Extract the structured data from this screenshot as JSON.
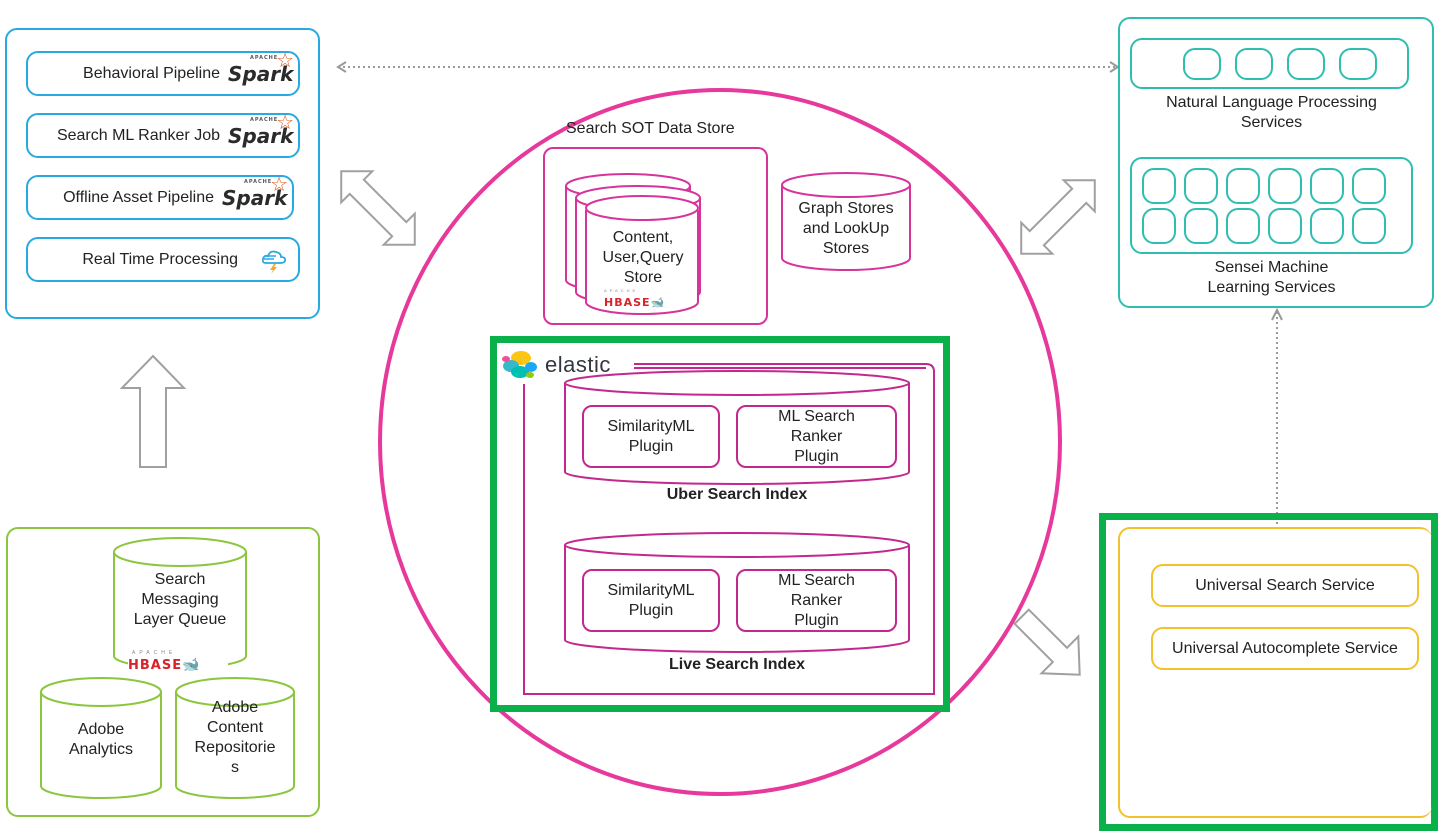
{
  "batch_panel": {
    "items": [
      {
        "label": "Behavioral Pipeline",
        "logo": "Spark",
        "logo_prefix": "APACHE",
        "icon": "spark-icon"
      },
      {
        "label": "Search ML Ranker Job",
        "logo": "Spark",
        "logo_prefix": "APACHE",
        "icon": "spark-icon"
      },
      {
        "label": "Offline Asset Pipeline",
        "logo": "Spark",
        "logo_prefix": "APACHE",
        "icon": "spark-icon"
      },
      {
        "label": "Real Time Processing",
        "icon": "storm-cloud-icon"
      }
    ]
  },
  "sources_panel": {
    "queue": {
      "label_lines": [
        "Search",
        "Messaging",
        "Layer Queue"
      ],
      "logo": "HBASE",
      "logo_prefix": "APACHE"
    },
    "analytics": {
      "label_lines": [
        "Adobe",
        "Analytics"
      ]
    },
    "repositories": {
      "label_lines": [
        "Adobe",
        "Content",
        "Repositorie",
        "s"
      ]
    }
  },
  "center": {
    "sot_title": "Search SOT Data Store",
    "content_store": {
      "label_lines": [
        "Content,",
        "User,Query",
        "Store"
      ],
      "logo": "HBASE",
      "logo_prefix": "APACHE"
    },
    "graph_store": {
      "label_lines": [
        "Graph Stores",
        "and LookUp",
        "Stores"
      ]
    },
    "elastic_logo": "elastic",
    "uber_index": {
      "title": "Uber Search Index",
      "plugins": [
        {
          "label_lines": [
            "SimilarityML",
            "Plugin"
          ]
        },
        {
          "label_lines": [
            "ML Search",
            "Ranker",
            "Plugin"
          ]
        }
      ]
    },
    "live_index": {
      "title": "Live Search Index",
      "plugins": [
        {
          "label_lines": [
            "SimilarityML",
            "Plugin"
          ]
        },
        {
          "label_lines": [
            "ML Search",
            "Ranker",
            "Plugin"
          ]
        }
      ]
    }
  },
  "ml_panel": {
    "nlp_title_lines": [
      "Natural Language Processing",
      "Services"
    ],
    "nlp_slots": 4,
    "sensei_title_lines": [
      "Sensei Machine",
      "Learning Services"
    ],
    "sensei_slots": 12
  },
  "services_panel": {
    "items": [
      {
        "label": "Universal Search Service"
      },
      {
        "label": "Universal Autocomplete Service"
      }
    ]
  },
  "colors": {
    "batch": "#29a9df",
    "ml": "#2fbdb0",
    "sources": "#8cc63f",
    "center_circle": "#e6399b",
    "highlight": "#0ab14b",
    "services": "#f2c12e",
    "arrow": "#a0a0a0"
  }
}
